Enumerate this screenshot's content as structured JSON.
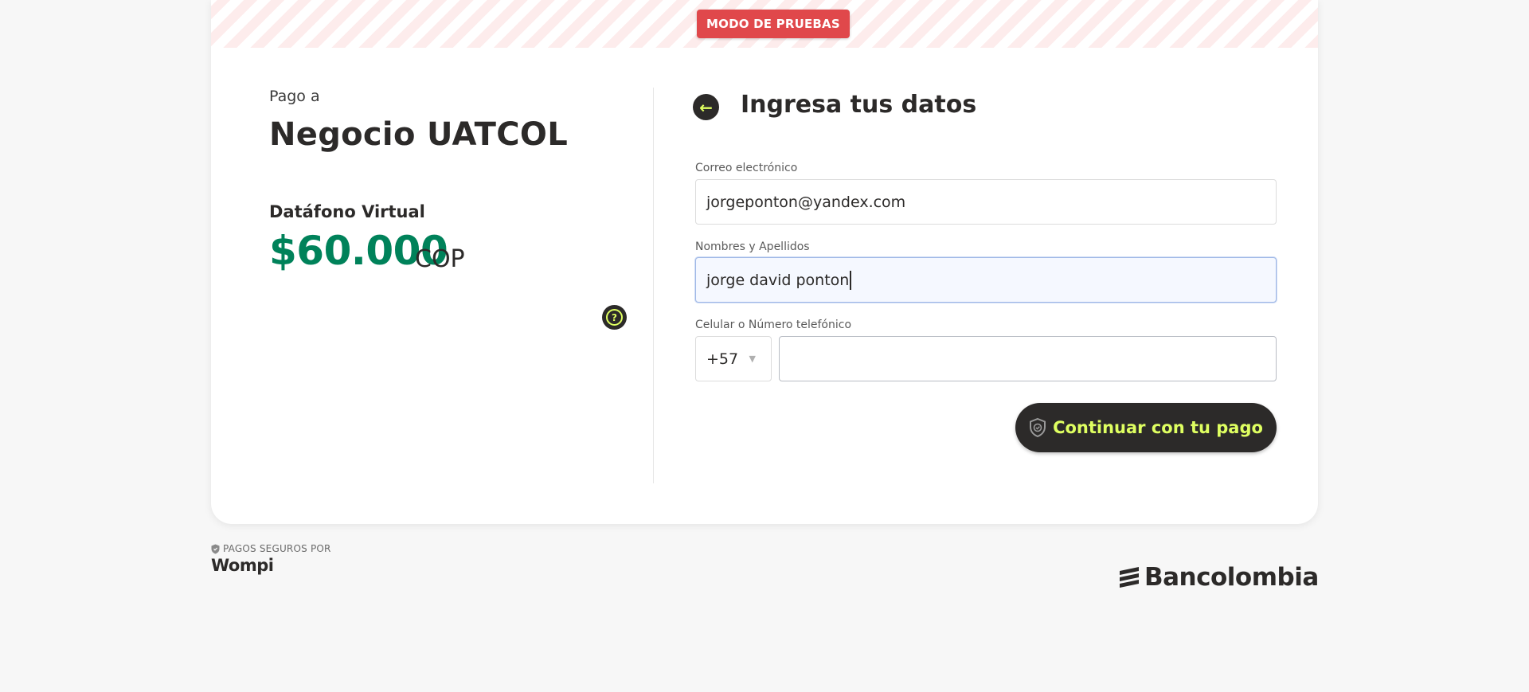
{
  "banner": {
    "test_mode": "MODO DE PRUEBAS"
  },
  "summary": {
    "pay_to_label": "Pago a",
    "merchant_name": "Negocio UATCOL",
    "product_name": "Datáfono Virtual",
    "amount": "$60.000",
    "currency": "COP",
    "help_icon": "?"
  },
  "form": {
    "title": "Ingresa tus datos",
    "back_icon": "←",
    "email_label": "Correo electrónico",
    "email_value": "jorgeponton@yandex.com",
    "name_label": "Nombres y Apellidos",
    "name_value": "jorge david ponton",
    "phone_label": "Celular o Número telefónico",
    "phone_prefix": "+57",
    "phone_value": "",
    "continue_label": "Continuar con tu pago"
  },
  "footer": {
    "secure_label": "PAGOS SEGUROS POR",
    "wompi": "Wompi",
    "bancolombia": "Bancolombia"
  },
  "colors": {
    "accent": "#dfff61",
    "dark": "#2c2a29",
    "amount_green": "#00825a",
    "test_badge_red": "#e0484b"
  }
}
